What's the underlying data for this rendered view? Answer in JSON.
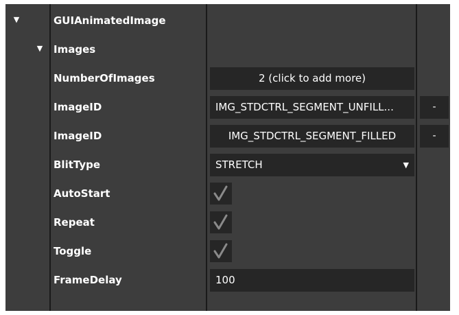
{
  "tree": {
    "root": {
      "label": "GUIAnimatedImage",
      "expand_icon": "triangle-down-icon"
    },
    "images": {
      "label": "Images",
      "expand_icon": "triangle-down-icon"
    }
  },
  "properties": {
    "number_of_images": {
      "label": "NumberOfImages",
      "value": "2 (click to add more)"
    },
    "image_ids": [
      {
        "label": "ImageID",
        "value": "IMG_STDCTRL_SEGMENT_UNFILL...",
        "remove_label": "-"
      },
      {
        "label": "ImageID",
        "value": "IMG_STDCTRL_SEGMENT_FILLED",
        "remove_label": "-"
      }
    ],
    "blit_type": {
      "label": "BlitType",
      "value": "STRETCH",
      "arrow_icon": "dropdown-arrow-icon"
    },
    "auto_start": {
      "label": "AutoStart",
      "checked": true
    },
    "repeat": {
      "label": "Repeat",
      "checked": true
    },
    "toggle": {
      "label": "Toggle",
      "checked": true
    },
    "frame_delay": {
      "label": "FrameDelay",
      "value": "100"
    }
  },
  "colors": {
    "panel_bg": "#3d3d3d",
    "field_bg": "#262626",
    "divider": "#1a1a1a",
    "text": "#ffffff",
    "check": "#8a8a8a"
  }
}
